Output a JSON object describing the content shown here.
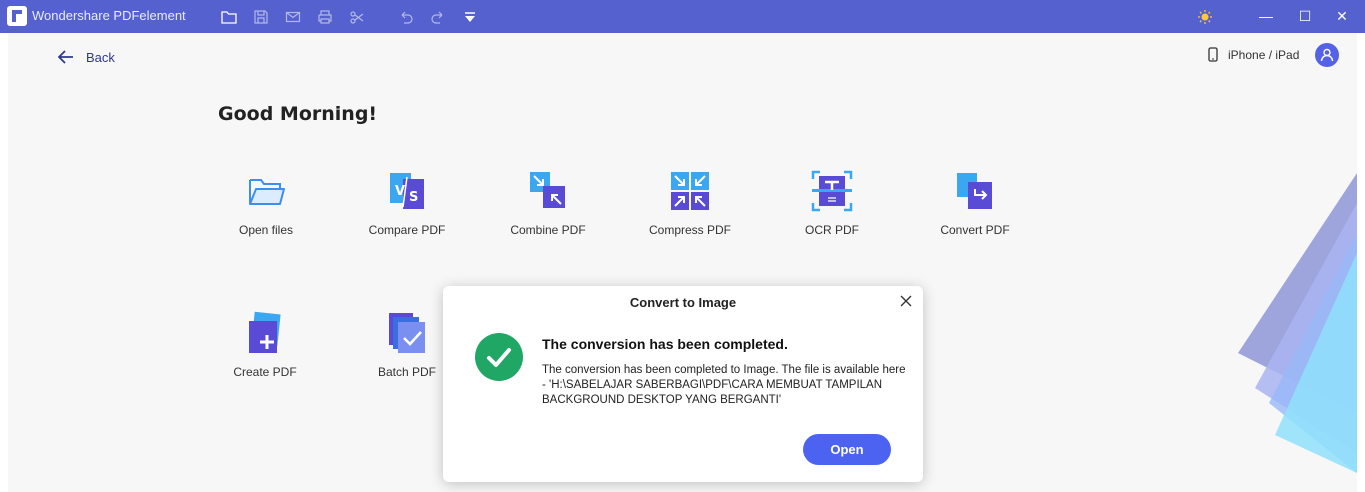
{
  "app": {
    "title": "Wondershare PDFelement"
  },
  "window": {
    "minimize": "—",
    "maximize": "☐",
    "close": "✕"
  },
  "header": {
    "back_label": "Back",
    "device_label": "iPhone / iPad"
  },
  "greeting": "Good Morning!",
  "tools": [
    {
      "label": "Open files",
      "icon": "open-files-icon"
    },
    {
      "label": "Compare PDF",
      "icon": "compare-pdf-icon"
    },
    {
      "label": "Combine PDF",
      "icon": "combine-pdf-icon"
    },
    {
      "label": "Compress PDF",
      "icon": "compress-pdf-icon"
    },
    {
      "label": "OCR PDF",
      "icon": "ocr-pdf-icon"
    },
    {
      "label": "Convert PDF",
      "icon": "convert-pdf-icon"
    },
    {
      "label": "Create PDF",
      "icon": "create-pdf-icon"
    },
    {
      "label": "Batch PDF",
      "icon": "batch-pdf-icon"
    }
  ],
  "dialog": {
    "title": "Convert to Image",
    "heading": "The conversion has been completed.",
    "message": "The conversion has been completed to Image. The file is available here - 'H:\\SABELAJAR SABERBAGI\\PDF\\CARA MEMBUAT TAMPILAN BACKGROUND DESKTOP YANG BERGANTI'",
    "open_label": "Open"
  },
  "colors": {
    "titlebar": "#5561cf",
    "accent": "#4c63f2",
    "success": "#21a765"
  }
}
